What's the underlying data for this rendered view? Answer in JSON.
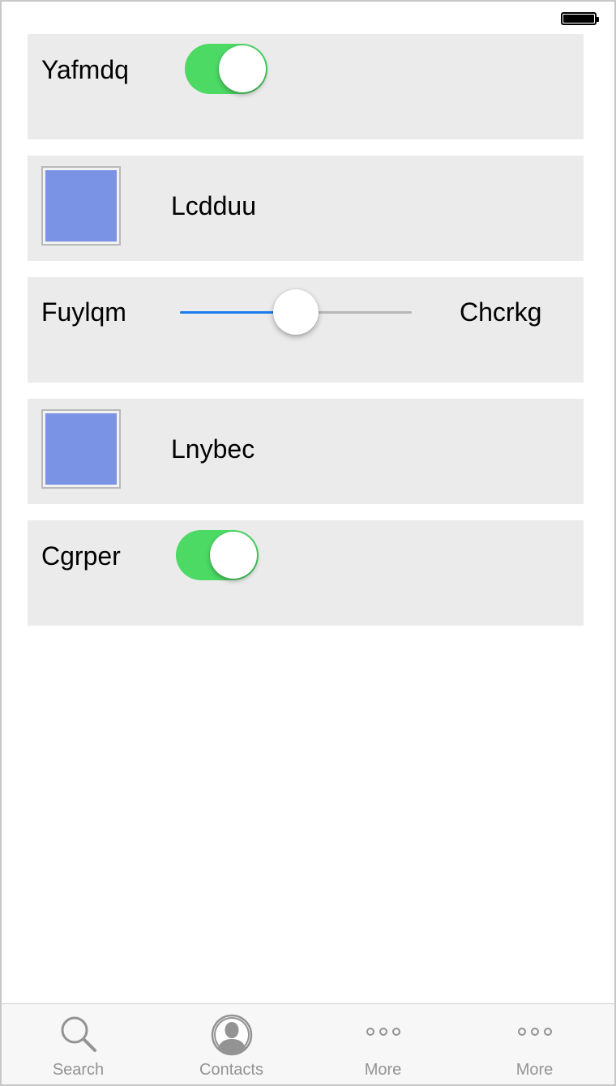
{
  "rows": [
    {
      "type": "toggle",
      "label": "Yafmdq",
      "on": true
    },
    {
      "type": "swatch",
      "label": "Lcdduu",
      "color": "#7b93e5"
    },
    {
      "type": "slider",
      "left_label": "Fuylqm",
      "right_label": "Chcrkg",
      "value": 0.5
    },
    {
      "type": "swatch",
      "label": "Lnybec",
      "color": "#7b93e5"
    },
    {
      "type": "toggle",
      "label": "Cgrper",
      "on": true
    }
  ],
  "tabbar": {
    "items": [
      {
        "label": "Search",
        "icon": "search-icon"
      },
      {
        "label": "Contacts",
        "icon": "contacts-icon"
      },
      {
        "label": "More",
        "icon": "more-icon"
      },
      {
        "label": "More",
        "icon": "more-icon"
      }
    ]
  },
  "colors": {
    "toggle_on": "#4cd964",
    "slider_active": "#1a7cf0",
    "row_background": "#ebebeb",
    "tab_inactive": "#939393"
  }
}
